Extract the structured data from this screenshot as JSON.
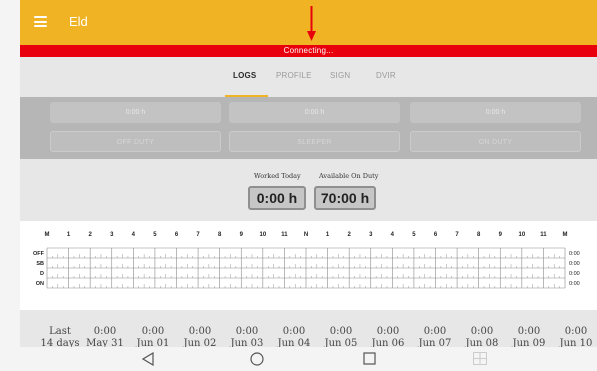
{
  "app": {
    "title": "Eld"
  },
  "connection": {
    "status": "Connecting..."
  },
  "tabs": [
    {
      "label": "LOGS",
      "active": true
    },
    {
      "label": "PROFILE",
      "active": false
    },
    {
      "label": "SIGN",
      "active": false
    },
    {
      "label": "DVIR",
      "active": false
    }
  ],
  "status_tiles": {
    "values": [
      "0:00 h",
      "0:00 h",
      "0:00 h"
    ],
    "labels": [
      "OFF DUTY",
      "SLEEPER",
      "ON DUTY"
    ]
  },
  "hours": {
    "worked_label": "Worked Today",
    "worked_value": "0:00 h",
    "available_label": "Available On Duty",
    "available_value": "70:00 h"
  },
  "log_graph": {
    "hour_labels": [
      "M",
      "1",
      "2",
      "3",
      "4",
      "5",
      "6",
      "7",
      "8",
      "9",
      "10",
      "11",
      "N",
      "1",
      "2",
      "3",
      "4",
      "5",
      "6",
      "7",
      "8",
      "9",
      "10",
      "11",
      "M"
    ],
    "rows": [
      "OFF",
      "SB",
      "D",
      "ON"
    ],
    "totals": [
      "0:00",
      "0:00",
      "0:00",
      "0:00"
    ]
  },
  "history": {
    "label_line1": "Last",
    "label_line2": "14 days",
    "days": [
      {
        "time": "0:00",
        "date": "May 31"
      },
      {
        "time": "0:00",
        "date": "Jun 01"
      },
      {
        "time": "0:00",
        "date": "Jun 02"
      },
      {
        "time": "0:00",
        "date": "Jun 03"
      },
      {
        "time": "0:00",
        "date": "Jun 04"
      },
      {
        "time": "0:00",
        "date": "Jun 05"
      },
      {
        "time": "0:00",
        "date": "Jun 06"
      },
      {
        "time": "0:00",
        "date": "Jun 07"
      },
      {
        "time": "0:00",
        "date": "Jun 08"
      },
      {
        "time": "0:00",
        "date": "Jun 09"
      },
      {
        "time": "0:00",
        "date": "Jun 10"
      }
    ]
  },
  "colors": {
    "app_bar": "#f0b323",
    "connection_bar": "#e8000d",
    "annotation_arrow": "#e8000d"
  },
  "nav": {
    "icons": [
      "back-icon",
      "home-icon",
      "recents-icon",
      "keyboard-icon"
    ]
  }
}
